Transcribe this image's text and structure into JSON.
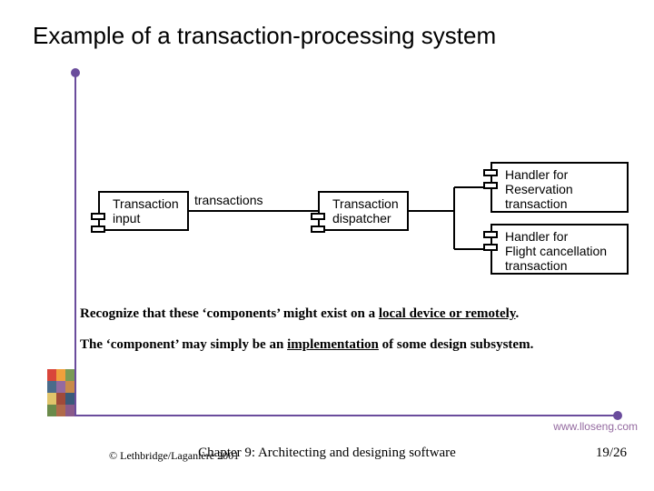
{
  "title": "Example of a transaction-processing system",
  "diagram": {
    "edge_label": "transactions",
    "components": {
      "input": "Transaction\ninput",
      "dispatcher": "Transaction\ndispatcher",
      "reservation": "Handler for\nReservation\ntransaction",
      "cancellation": "Handler for\nFlight cancellation\ntransaction"
    }
  },
  "body": {
    "p1_a": "Recognize that these ‘components’ might exist on a ",
    "p1_u": "local device or remotely",
    "p1_b": ".",
    "p2_a": "The ‘component’ may simply be an ",
    "p2_u": "implementation",
    "p2_b": " of some design subsystem."
  },
  "site": "www.lloseng.com",
  "footer": {
    "copyright": "© Lethbridge/Laganière 2001",
    "chapter": "Chapter 9: Architecting and designing software",
    "page": "19/26"
  }
}
